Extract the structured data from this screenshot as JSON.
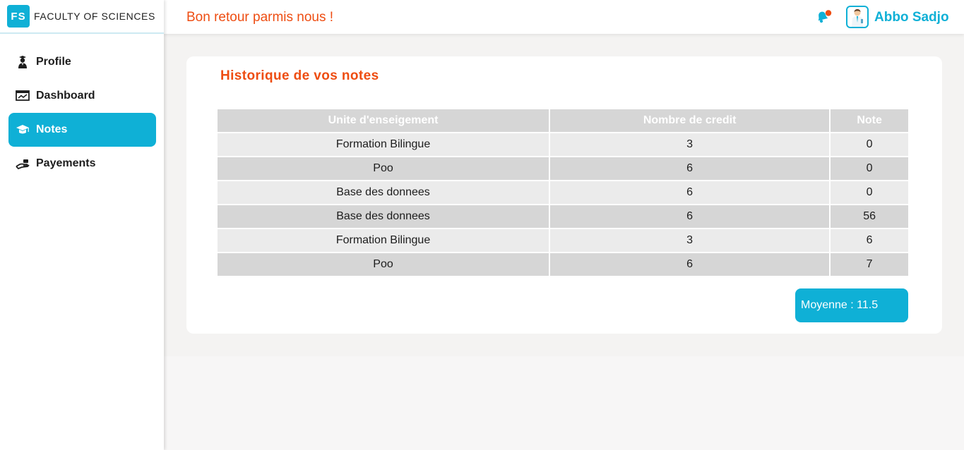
{
  "brand": {
    "logo": "FS",
    "name": "FACULTY OF SCIENCES",
    "accent": "#0fb0d6"
  },
  "sidebar": {
    "items": [
      {
        "label": "Profile",
        "icon": "graduate-user-icon",
        "active": false
      },
      {
        "label": "Dashboard",
        "icon": "chart-board-icon",
        "active": false
      },
      {
        "label": "Notes",
        "icon": "graduation-cap-icon",
        "active": true
      },
      {
        "label": "Payements",
        "icon": "hand-money-icon",
        "active": false
      }
    ]
  },
  "header": {
    "welcome": "Bon retour parmis nous !",
    "welcome_color": "#ee4d12",
    "user_name": "Abbo Sadjo",
    "icons": [
      "bell-icon",
      "avatar"
    ]
  },
  "main": {
    "title": "Historique de vos notes",
    "table": {
      "columns": [
        "Unite d'enseigement",
        "Nombre de credit",
        "Note"
      ],
      "rows": [
        [
          "Formation Bilingue",
          "3",
          "0"
        ],
        [
          "Poo",
          "6",
          "0"
        ],
        [
          "Base des donnees",
          "6",
          "0"
        ],
        [
          "Base des donnees",
          "6",
          "56"
        ],
        [
          "Formation Bilingue",
          "3",
          "6"
        ],
        [
          "Poo",
          "6",
          "7"
        ]
      ]
    },
    "average": "Moyenne : 11.5"
  }
}
